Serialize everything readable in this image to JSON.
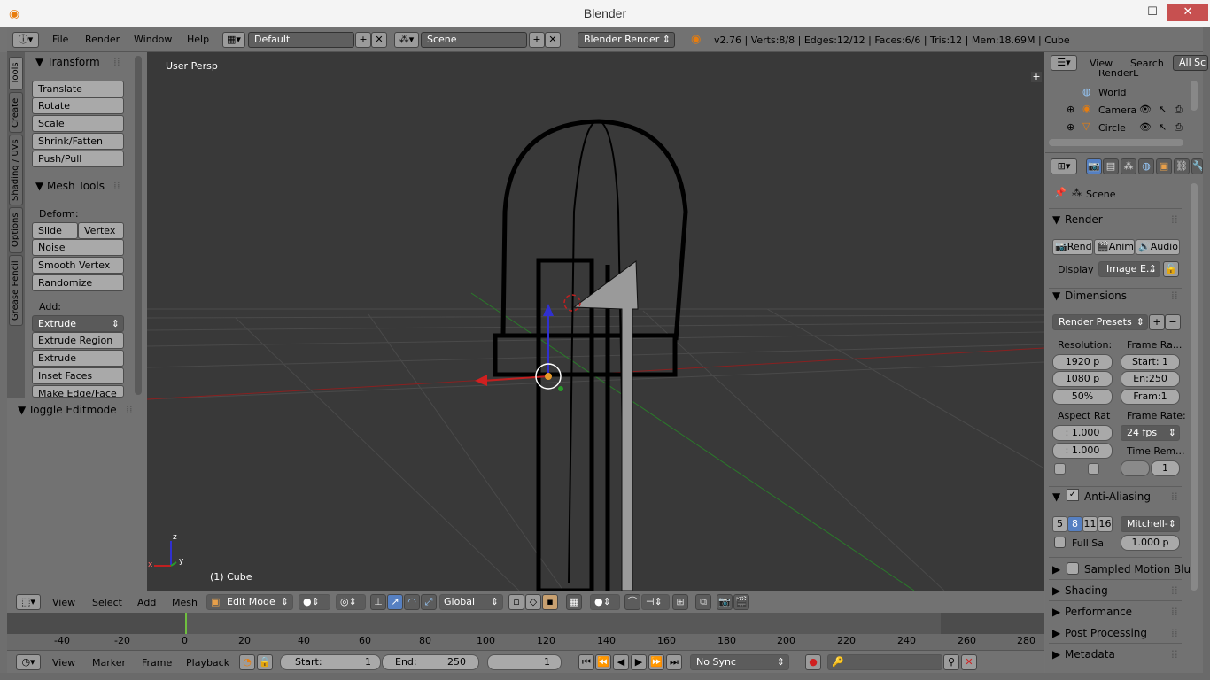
{
  "window": {
    "title": "Blender"
  },
  "info_bar": {
    "menus": [
      "File",
      "Render",
      "Window",
      "Help"
    ],
    "layout": "Default",
    "scene": "Scene",
    "engine": "Blender Render",
    "stats": "v2.76 | Verts:8/8 | Edges:12/12 | Faces:6/6 | Tris:12 | Mem:18.69M | Cube"
  },
  "tabs": [
    "Tools",
    "Create",
    "Shading / UVs",
    "Options",
    "Grease Pencil"
  ],
  "tool_shelf": {
    "transform": {
      "title": "Transform",
      "buttons": [
        "Translate",
        "Rotate",
        "Scale",
        "Shrink/Fatten",
        "Push/Pull"
      ]
    },
    "mesh_tools": {
      "title": "Mesh Tools",
      "deform_label": "Deform:",
      "slide_edge": "Slide Ed",
      "vertex": "Vertex",
      "deform_buttons": [
        "Noise",
        "Smooth Vertex",
        "Randomize"
      ],
      "add_label": "Add:",
      "extrude": "Extrude",
      "add_buttons": [
        "Extrude Region",
        "Extrude Individual",
        "Inset Faces",
        "Make Edge/Face"
      ]
    }
  },
  "operator_panel": {
    "title": "Toggle Editmode"
  },
  "viewport": {
    "view_name": "User Persp",
    "object_label": "(1) Cube",
    "axis_x": "x",
    "axis_y": "y",
    "axis_z": "z"
  },
  "view3d_header": {
    "menus": [
      "View",
      "Select",
      "Add",
      "Mesh"
    ],
    "mode": "Edit Mode",
    "orientation": "Global"
  },
  "timeline": {
    "ticks": [
      "-40",
      "-20",
      "0",
      "20",
      "40",
      "60",
      "80",
      "100",
      "120",
      "140",
      "160",
      "180",
      "200",
      "220",
      "240",
      "260",
      "280"
    ],
    "current_frame_marker": 0
  },
  "timeline_header": {
    "menus": [
      "View",
      "Marker",
      "Frame",
      "Playback"
    ],
    "start_label": "Start:",
    "start_value": "1",
    "end_label": "End:",
    "end_value": "250",
    "current": "1",
    "sync": "No Sync"
  },
  "outliner": {
    "menus": [
      "View",
      "Search"
    ],
    "filter": "All Sc",
    "rows": [
      "RenderL",
      "World",
      "Camera",
      "Circle"
    ]
  },
  "properties": {
    "context": "Scene",
    "render": {
      "title": "Render",
      "rend": "Rend",
      "anim": "Anim",
      "audio": "Audio",
      "display_label": "Display",
      "display_value": "Image E..."
    },
    "dimensions": {
      "title": "Dimensions",
      "presets": "Render Presets",
      "resolution_label": "Resolution:",
      "res_x": "1920 p",
      "res_y": "1080 p",
      "res_pct": "50%",
      "frame_range_label": "Frame Ra...",
      "start": "Start: 1",
      "end": "En:250",
      "step": "Fram:1",
      "aspect_label": "Aspect Rat",
      "aspect_x": ": 1.000",
      "aspect_y": ": 1.000",
      "frame_rate_label": "Frame Rate:",
      "frame_rate": "24 fps",
      "time_remap_label": "Time Rem...",
      "time_remap_value": "1"
    },
    "anti_aliasing": {
      "title": "Anti-Aliasing",
      "samples": [
        "5",
        "8",
        "11",
        "16"
      ],
      "selected_sample": "8",
      "filter": "Mitchell-",
      "full_sample": "Full Sa",
      "filter_size": "1.000 p"
    },
    "collapsed": [
      "Sampled Motion Blur",
      "Shading",
      "Performance",
      "Post Processing",
      "Metadata"
    ]
  }
}
